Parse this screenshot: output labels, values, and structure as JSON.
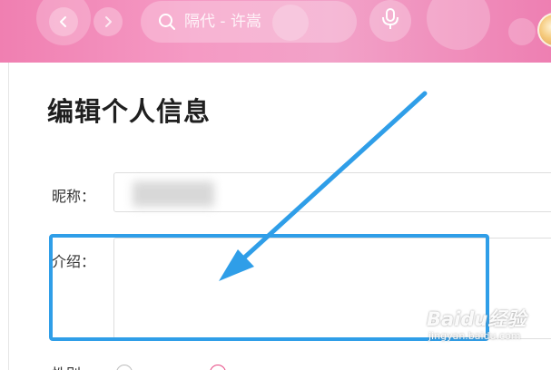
{
  "header": {
    "search_placeholder": "隔代 - 许嵩",
    "back_icon": "chevron-left-icon",
    "forward_icon": "chevron-right-icon",
    "search_icon": "search-icon",
    "mic_icon": "microphone-icon"
  },
  "form": {
    "title": "编辑个人信息",
    "nickname_label": "昵称：",
    "intro_label": "介绍：",
    "gender_label": "性别："
  },
  "watermark": {
    "main": "Baidu经验",
    "sub": "jingyan.baidu.com"
  },
  "colors": {
    "header_pink": "#f07fb1",
    "highlight_blue": "#2f9ee8",
    "radio_checked": "#e74a84"
  }
}
